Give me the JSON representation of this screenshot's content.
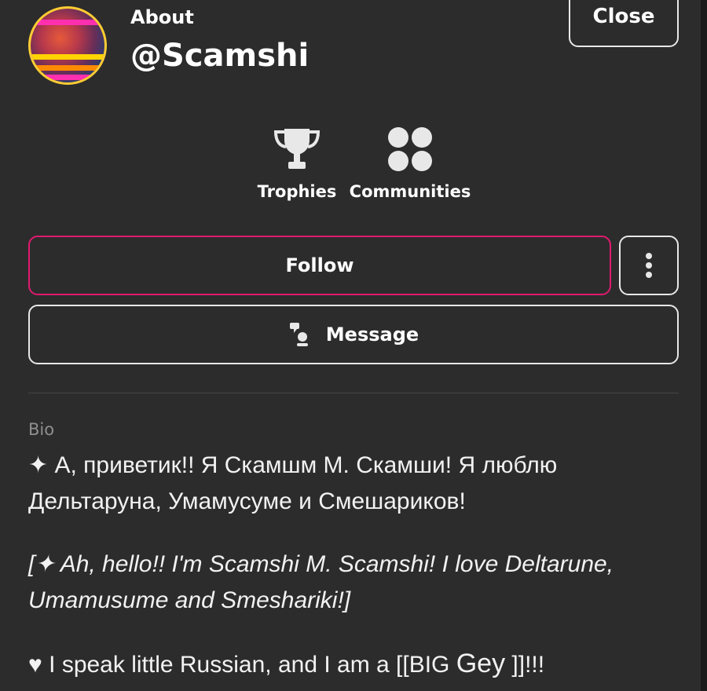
{
  "header": {
    "label": "About",
    "username": "@Scamshi",
    "close_label": "Close"
  },
  "stats": [
    {
      "label": "Trophies",
      "icon": "trophy-icon"
    },
    {
      "label": "Communities",
      "icon": "communities-icon"
    }
  ],
  "actions": {
    "follow_label": "Follow",
    "more_icon": "more-vertical-icon",
    "message_label": "Message",
    "message_icon": "message-icon"
  },
  "bio": {
    "label": "Bio",
    "paragraph1": "✦ А, приветик!! Я Скамшм М. Скамши! Я люблю Дельтаруна, Умамусуме и Смешариков!",
    "paragraph2": "[✦ Ah, hello!! I'm Scamshi M. Scamshi! I love Deltarune, Umamusume and Smeshariki!]",
    "paragraph3_prefix": "♥ I speak little Russian, and I am a [[BIG ",
    "paragraph3_emph": "Gey",
    "paragraph3_suffix": " ]]!!!"
  },
  "colors": {
    "background": "#2c2c2c",
    "accent": "#e01a6f",
    "text": "#ffffff",
    "muted": "#8f8f8f"
  }
}
